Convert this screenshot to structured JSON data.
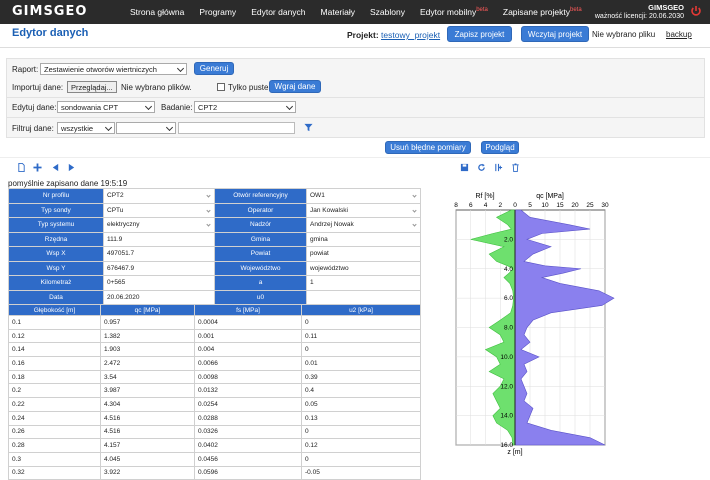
{
  "app": {
    "logo": "GIMSGEO",
    "nav": [
      {
        "label": "Strona główna",
        "beta": ""
      },
      {
        "label": "Programy",
        "beta": ""
      },
      {
        "label": "Edytor danych",
        "beta": ""
      },
      {
        "label": "Materiały",
        "beta": ""
      },
      {
        "label": "Szablony",
        "beta": ""
      },
      {
        "label": "Edytor mobilny",
        "beta": "beta"
      },
      {
        "label": "Zapisane projekty",
        "beta": "beta"
      }
    ],
    "account_name": "GIMSGEO",
    "license": "ważność licencji: 20.06.2030"
  },
  "header": {
    "title": "Edytor danych",
    "project_label": "Projekt:",
    "project_name": "testowy_projekt",
    "save_label": "Zapisz projekt",
    "load_label": "Wczytaj projekt",
    "no_file": "Nie wybrano pliku",
    "backup": "backup"
  },
  "form": {
    "report_label": "Raport:",
    "report_value": "Zestawienie otworów wiertniczych",
    "generate": "Generuj",
    "import_label": "Importuj dane:",
    "browse": "Przeglądaj...",
    "no_files": "Nie wybrano plików.",
    "only_empty": "Tylko puste",
    "upload": "Wgraj dane",
    "edit_label": "Edytuj dane:",
    "edit_value": "sondowania CPT",
    "test_label": "Badanie:",
    "test_value": "CPT2",
    "filter_label": "Filtruj dane:",
    "filter_value": "wszystkie",
    "remove_bad": "Usuń błędne pomiary",
    "preview": "Podgląd"
  },
  "status": "pomyślnie zapisano dane 19:5:19",
  "info_rows": [
    [
      "Nr profilu",
      "CPT2",
      "Otwór referencyjny",
      "OW1"
    ],
    [
      "Typ sondy",
      "CPTu",
      "Operator",
      "Jan Kowalski"
    ],
    [
      "Typ systemu",
      "elektryczny",
      "Nadzór",
      "Andrzej Nowak"
    ],
    [
      "Rzędna",
      "111.9",
      "Gmina",
      "gmina"
    ],
    [
      "Wsp X",
      "497051.7",
      "Powiat",
      "powiat"
    ],
    [
      "Wsp Y",
      "676467.9",
      "Województwo",
      "województwo"
    ],
    [
      "Kilometraż",
      "0+565",
      "a",
      "1"
    ],
    [
      "Data",
      "20.06.2020",
      "u0",
      ""
    ]
  ],
  "data_headers": [
    "Głębokość [m]",
    "qc [MPa]",
    "fs [MPa]",
    "u2 [kPa]"
  ],
  "data_rows": [
    [
      "0.1",
      "0.957",
      "0.0004",
      "0"
    ],
    [
      "0.12",
      "1.382",
      "0.001",
      "0.11"
    ],
    [
      "0.14",
      "1.903",
      "0.004",
      "0"
    ],
    [
      "0.16",
      "2.472",
      "0.0066",
      "0.01"
    ],
    [
      "0.18",
      "3.54",
      "0.0098",
      "0.39"
    ],
    [
      "0.2",
      "3.987",
      "0.0132",
      "0.4"
    ],
    [
      "0.22",
      "4.304",
      "0.0254",
      "0.05"
    ],
    [
      "0.24",
      "4.516",
      "0.0288",
      "0.13"
    ],
    [
      "0.26",
      "4.516",
      "0.0326",
      "0"
    ],
    [
      "0.28",
      "4.157",
      "0.0402",
      "0.12"
    ],
    [
      "0.3",
      "4.045",
      "0.0456",
      "0"
    ],
    [
      "0.32",
      "3.922",
      "0.0596",
      "-0.05"
    ]
  ],
  "chart_data": {
    "type": "area",
    "rf_label": "Rf [%]",
    "qc_label": "qc [MPa]",
    "depth_label": "z [m]",
    "rf_ticks": [
      8,
      6,
      4,
      2,
      0
    ],
    "qc_ticks": [
      0,
      5,
      10,
      15,
      20,
      25,
      30
    ],
    "depth_ticks": [
      2.0,
      4.0,
      6.0,
      8.0,
      10.0,
      12.0,
      14.0,
      16.0
    ],
    "qc_series": {
      "name": "qc",
      "color": "#8a80ee",
      "z": [
        0,
        0.5,
        1.0,
        1.3,
        1.6,
        2.0,
        2.5,
        3.0,
        3.5,
        3.8,
        4.0,
        4.3,
        4.6,
        5.0,
        5.5,
        6.0,
        6.5,
        7.0,
        7.5,
        8.0,
        8.5,
        9.0,
        9.5,
        10.0,
        10.5,
        11.0,
        11.5,
        12.0,
        12.5,
        13.0,
        13.5,
        14.0,
        14.5,
        15.0,
        15.5,
        16.0
      ],
      "qc": [
        2,
        5,
        18,
        25,
        9,
        4,
        12,
        6,
        3,
        10,
        22,
        16,
        9,
        15,
        28,
        33,
        29,
        12,
        6,
        4,
        3,
        5,
        2,
        8,
        3,
        4,
        2,
        3,
        4,
        3,
        6,
        5,
        4,
        12,
        25,
        30
      ]
    },
    "rf_series": {
      "name": "Rf",
      "color": "#6ee06e",
      "z": [
        0,
        0.5,
        1.0,
        1.3,
        1.6,
        2.0,
        2.5,
        3.0,
        3.5,
        3.8,
        4.0,
        4.3,
        4.6,
        5.0,
        5.5,
        6.0,
        6.5,
        7.0,
        7.5,
        8.0,
        8.5,
        9.0,
        9.5,
        10.0,
        10.5,
        11.0,
        11.5,
        12.0,
        12.5,
        13.0,
        13.5,
        14.0,
        14.5,
        15.0,
        15.5,
        16.0
      ],
      "rf": [
        0.5,
        2.5,
        1.0,
        0.5,
        3.0,
        6.0,
        1.5,
        3.5,
        2.5,
        1.0,
        0.3,
        0.8,
        1.5,
        0.7,
        0.3,
        0.2,
        0.3,
        0.6,
        2.0,
        3.5,
        2.0,
        1.5,
        4.0,
        2.5,
        2.0,
        3.5,
        1.5,
        2.0,
        3.0,
        2.5,
        2.0,
        3.0,
        2.5,
        1.0,
        0.4,
        0.3
      ]
    },
    "rf_range": [
      0,
      8
    ],
    "qc_range": [
      0,
      30
    ],
    "depth_range": [
      0,
      16
    ]
  }
}
